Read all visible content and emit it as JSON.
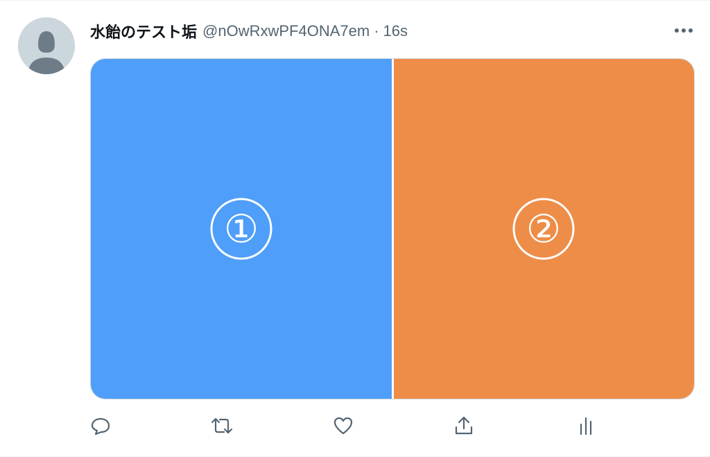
{
  "tweet": {
    "display_name": "水飴のテスト垢",
    "handle": "@nOwRxwPF4ONA7em",
    "separator": "·",
    "time": "16s",
    "more_icon": "more-dots-icon",
    "avatar_icon": "default-profile-icon"
  },
  "media": [
    {
      "label": "①",
      "color": "#4f9ef9"
    },
    {
      "label": "②",
      "color": "#ee8d48"
    }
  ],
  "actions": [
    {
      "name": "reply",
      "icon": "reply-icon"
    },
    {
      "name": "retweet",
      "icon": "retweet-icon"
    },
    {
      "name": "like",
      "icon": "heart-icon"
    },
    {
      "name": "share",
      "icon": "share-icon"
    },
    {
      "name": "analytics",
      "icon": "analytics-icon"
    }
  ],
  "colors": {
    "text_primary": "#0f1419",
    "text_secondary": "#536471",
    "icon": "#536471",
    "avatar_bg": "#ccd6dd",
    "avatar_fg": "#6e7c88"
  }
}
